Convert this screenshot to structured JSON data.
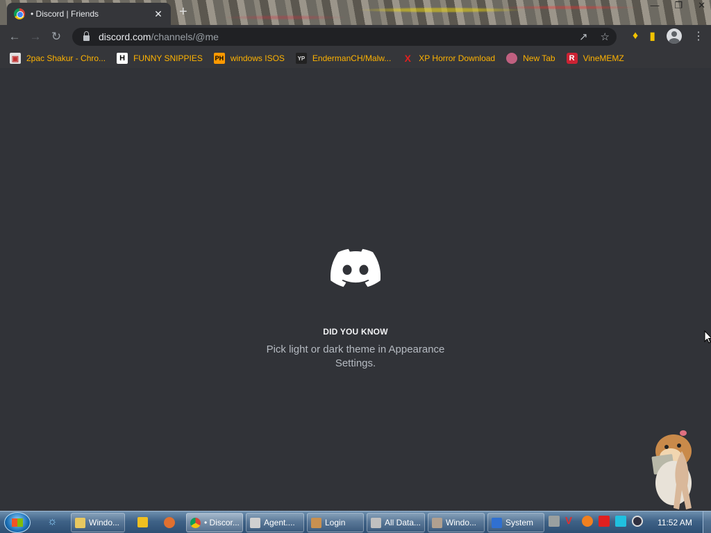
{
  "browser": {
    "tab_title": "• Discord | Friends",
    "tab_close": "✕",
    "new_tab": "+",
    "url_host": "discord.com",
    "url_path": "/channels/@me",
    "window_controls": [
      "—",
      "❐",
      "✕"
    ]
  },
  "bookmarks": [
    {
      "label": "2pac Shakur - Chro...",
      "icon": "bookmark-favicon",
      "color": "#e84040"
    },
    {
      "label": "FUNNY SNIPPIES",
      "icon": "H",
      "color": "#ffffff"
    },
    {
      "label": "windows ISOS",
      "icon": "PH",
      "color": "#ff9900"
    },
    {
      "label": "EndermanCH/Malw...",
      "icon": "YP",
      "color": "#222222"
    },
    {
      "label": "XP Horror Download",
      "icon": "X",
      "color": "#e02020"
    },
    {
      "label": "New Tab",
      "icon": "globe",
      "color": "#c06080"
    },
    {
      "label": "VineMEMZ",
      "icon": "R",
      "color": "#cc2233"
    }
  ],
  "page": {
    "tip_heading": "DID YOU KNOW",
    "tip_text": "Pick light or dark theme in Appearance Settings.",
    "brand_color": "#ffffff",
    "background_color": "#313338"
  },
  "taskbar": {
    "tasks": [
      {
        "label": "Windo...",
        "icon": "explorer-folder-icon",
        "color": "#e8c860",
        "active": false
      },
      {
        "label": "• Discor...",
        "icon": "chrome-icon",
        "color": "#db4437",
        "active": true
      },
      {
        "label": "Agent....",
        "icon": "window-icon",
        "color": "#d0d0d0",
        "active": false
      },
      {
        "label": "Login",
        "icon": "user-icon",
        "color": "#c89050",
        "active": false
      },
      {
        "label": "All Data...",
        "icon": "document-icon",
        "color": "#c0c0c0",
        "active": false
      },
      {
        "label": "Windo...",
        "icon": "tools-icon",
        "color": "#b0a090",
        "active": false
      },
      {
        "label": "System",
        "icon": "system-icon",
        "color": "#3070d0",
        "active": false
      }
    ],
    "clock": "11:52 AM"
  }
}
